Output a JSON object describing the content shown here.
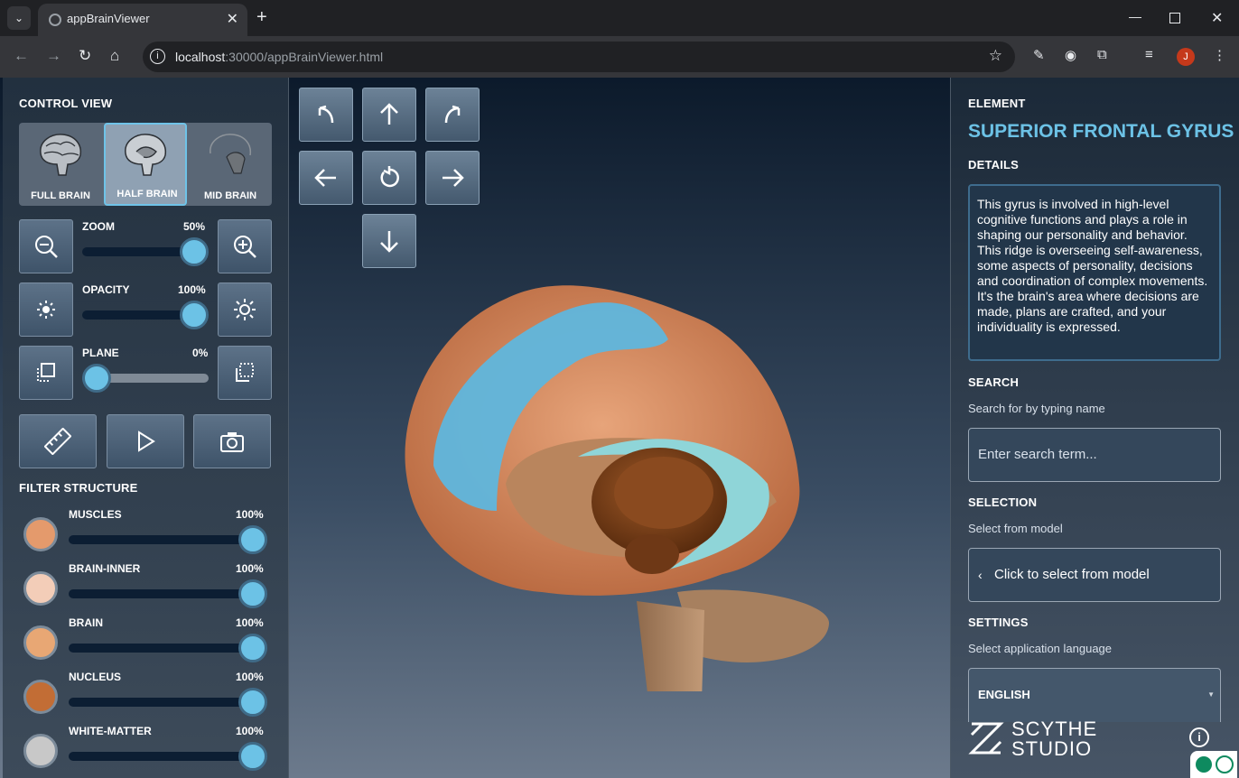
{
  "browser": {
    "tab_title": "appBrainViewer",
    "url_host": "localhost",
    "url_rest": ":30000/appBrainViewer.html",
    "avatar_letter": "J"
  },
  "left": {
    "control_view_title": "CONTROL VIEW",
    "views": [
      {
        "label": "FULL BRAIN",
        "selected": false
      },
      {
        "label": "HALF BRAIN",
        "selected": true
      },
      {
        "label": "MID BRAIN",
        "selected": false
      }
    ],
    "zoom": {
      "label": "ZOOM",
      "value": "50%",
      "fraction": 0.5
    },
    "opacity": {
      "label": "OPACITY",
      "value": "100%",
      "fraction": 1.0
    },
    "plane": {
      "label": "PLANE",
      "value": "0%",
      "fraction": 0.0
    },
    "filter_title": "FILTER STRUCTURE",
    "filters": [
      {
        "label": "MUSCLES",
        "value": "100%",
        "color": "#e49a6c"
      },
      {
        "label": "BRAIN-INNER",
        "value": "100%",
        "color": "#f3cdb8"
      },
      {
        "label": "BRAIN",
        "value": "100%",
        "color": "#e8a774"
      },
      {
        "label": "NUCLEUS",
        "value": "100%",
        "color": "#c26d35"
      },
      {
        "label": "WHITE-MATTER",
        "value": "100%",
        "color": "#c8c8c8"
      }
    ]
  },
  "right": {
    "element_title": "ELEMENT",
    "element_name": "SUPERIOR FRONTAL GYRUS",
    "details_title": "DETAILS",
    "details_text": "This gyrus is involved in high-level cognitive functions and plays a role in shaping our personality and behavior. This ridge is overseeing self-awareness, some aspects of personality, decisions and coordination of complex movements. It's the brain's area where decisions are made, plans are crafted, and your individuality is expressed.",
    "search_title": "SEARCH",
    "search_hint": "Search for by typing name",
    "search_placeholder": "Enter search term...",
    "selection_title": "SELECTION",
    "selection_hint": "Select from model",
    "selection_button": "Click to select from model",
    "settings_title": "SETTINGS",
    "settings_hint": "Select application language",
    "language": "ENGLISH",
    "logo_text_1": "SCYTHE",
    "logo_text_2": "STUDIO"
  }
}
